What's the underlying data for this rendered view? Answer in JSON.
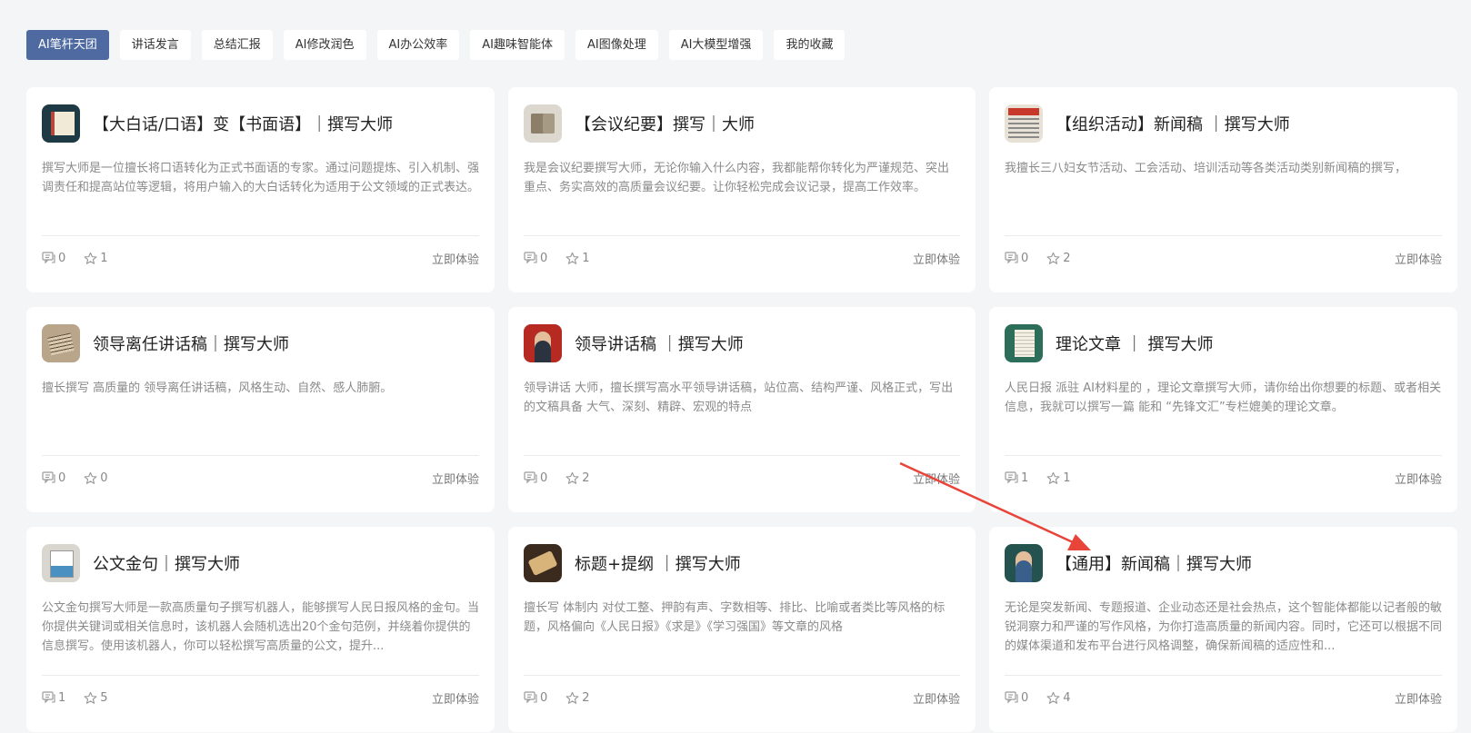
{
  "tabs": [
    {
      "label": "AI笔杆天团"
    },
    {
      "label": "讲话发言"
    },
    {
      "label": "总结汇报"
    },
    {
      "label": "AI修改润色"
    },
    {
      "label": "AI办公效率"
    },
    {
      "label": "AI趣味智能体"
    },
    {
      "label": "AI图像处理"
    },
    {
      "label": "AI大模型增强"
    },
    {
      "label": "我的收藏"
    }
  ],
  "active_tab": "AI笔杆天团",
  "colors": {
    "accent": "#4e6aa1",
    "annotation_arrow": "#e8443a"
  },
  "cards": [
    {
      "title": "【大白话/口语】变【书面语】｜撰写大师",
      "desc": "撰写大师是一位擅长将口语转化为正式书面语的专家。通过问题提炼、引入机制、强调责任和提高站位等逻辑，将用户输入的大白话转化为适用于公文领域的正式表达。",
      "comments": "0",
      "stars": "1",
      "action": "立即体验",
      "icon": "notebook-icon"
    },
    {
      "title": "【会议纪要】撰写｜大师",
      "desc": "我是会议纪要撰写大师，无论你输入什么内容，我都能帮你转化为严谨规范、突出重点、务实高效的高质量会议纪要。让你轻松完成会议记录，提高工作效率。",
      "comments": "0",
      "stars": "1",
      "action": "立即体验",
      "icon": "open-book-icon"
    },
    {
      "title": "【组织活动】新闻稿 ｜撰写大师",
      "desc": "我擅长三八妇女节活动、工会活动、培训活动等各类活动类别新闻稿的撰写，",
      "comments": "0",
      "stars": "2",
      "action": "立即体验",
      "icon": "newspaper-icon"
    },
    {
      "title": "领导离任讲话稿｜撰写大师",
      "desc": "擅长撰写 高质量的 领导离任讲话稿，风格生动、自然、感人肺腑。",
      "comments": "0",
      "stars": "0",
      "action": "立即体验",
      "icon": "writing-pen-icon"
    },
    {
      "title": "领导讲话稿 ｜撰写大师",
      "desc": "领导讲话 大师，擅长撰写高水平领导讲话稿，站位高、结构严谨、风格正式，写出的文稿具备 大气、深刻、精辟、宏观的特点",
      "comments": "0",
      "stars": "2",
      "action": "立即体验",
      "icon": "leader-speech-icon"
    },
    {
      "title": "理论文章 ｜ 撰写大师",
      "desc": "人民日报 派驻 AI材料星的 ，理论文章撰写大师，请你给出你想要的标题、或者相关信息，我就可以撰写一篇 能和 “先锋文汇”专栏媲美的理论文章。",
      "comments": "1",
      "stars": "1",
      "action": "立即体验",
      "icon": "paper-document-icon"
    },
    {
      "title": "公文金句｜撰写大师",
      "desc": "公文金句撰写大师是一款高质量句子撰写机器人，能够撰写人民日报风格的金句。当你提供关键词或相关信息时，该机器人会随机选出20个金句范例，并绕着你提供的信息撰写。使用该机器人，你可以轻松撰写高质量的公文，提升...",
      "comments": "1",
      "stars": "5",
      "action": "立即体验",
      "icon": "document-icon"
    },
    {
      "title": "标题+提纲 ｜撰写大师",
      "desc": "擅长写 体制内 对仗工整、押韵有声、字数相等、排比、比喻或者类比等风格的标题，风格偏向《人民日报》《求是》《学习强国》等文章的风格",
      "comments": "0",
      "stars": "2",
      "action": "立即体验",
      "icon": "scroll-icon"
    },
    {
      "title": "【通用】新闻稿｜撰写大师",
      "desc": "无论是突发新闻、专题报道、企业动态还是社会热点，这个智能体都能以记者般的敏锐洞察力和严谨的写作风格，为你打造高质量的新闻内容。同时，它还可以根据不同的媒体渠道和发布平台进行风格调整，确保新闻稿的适应性和...",
      "comments": "0",
      "stars": "4",
      "action": "立即体验",
      "icon": "reporter-icon"
    }
  ]
}
